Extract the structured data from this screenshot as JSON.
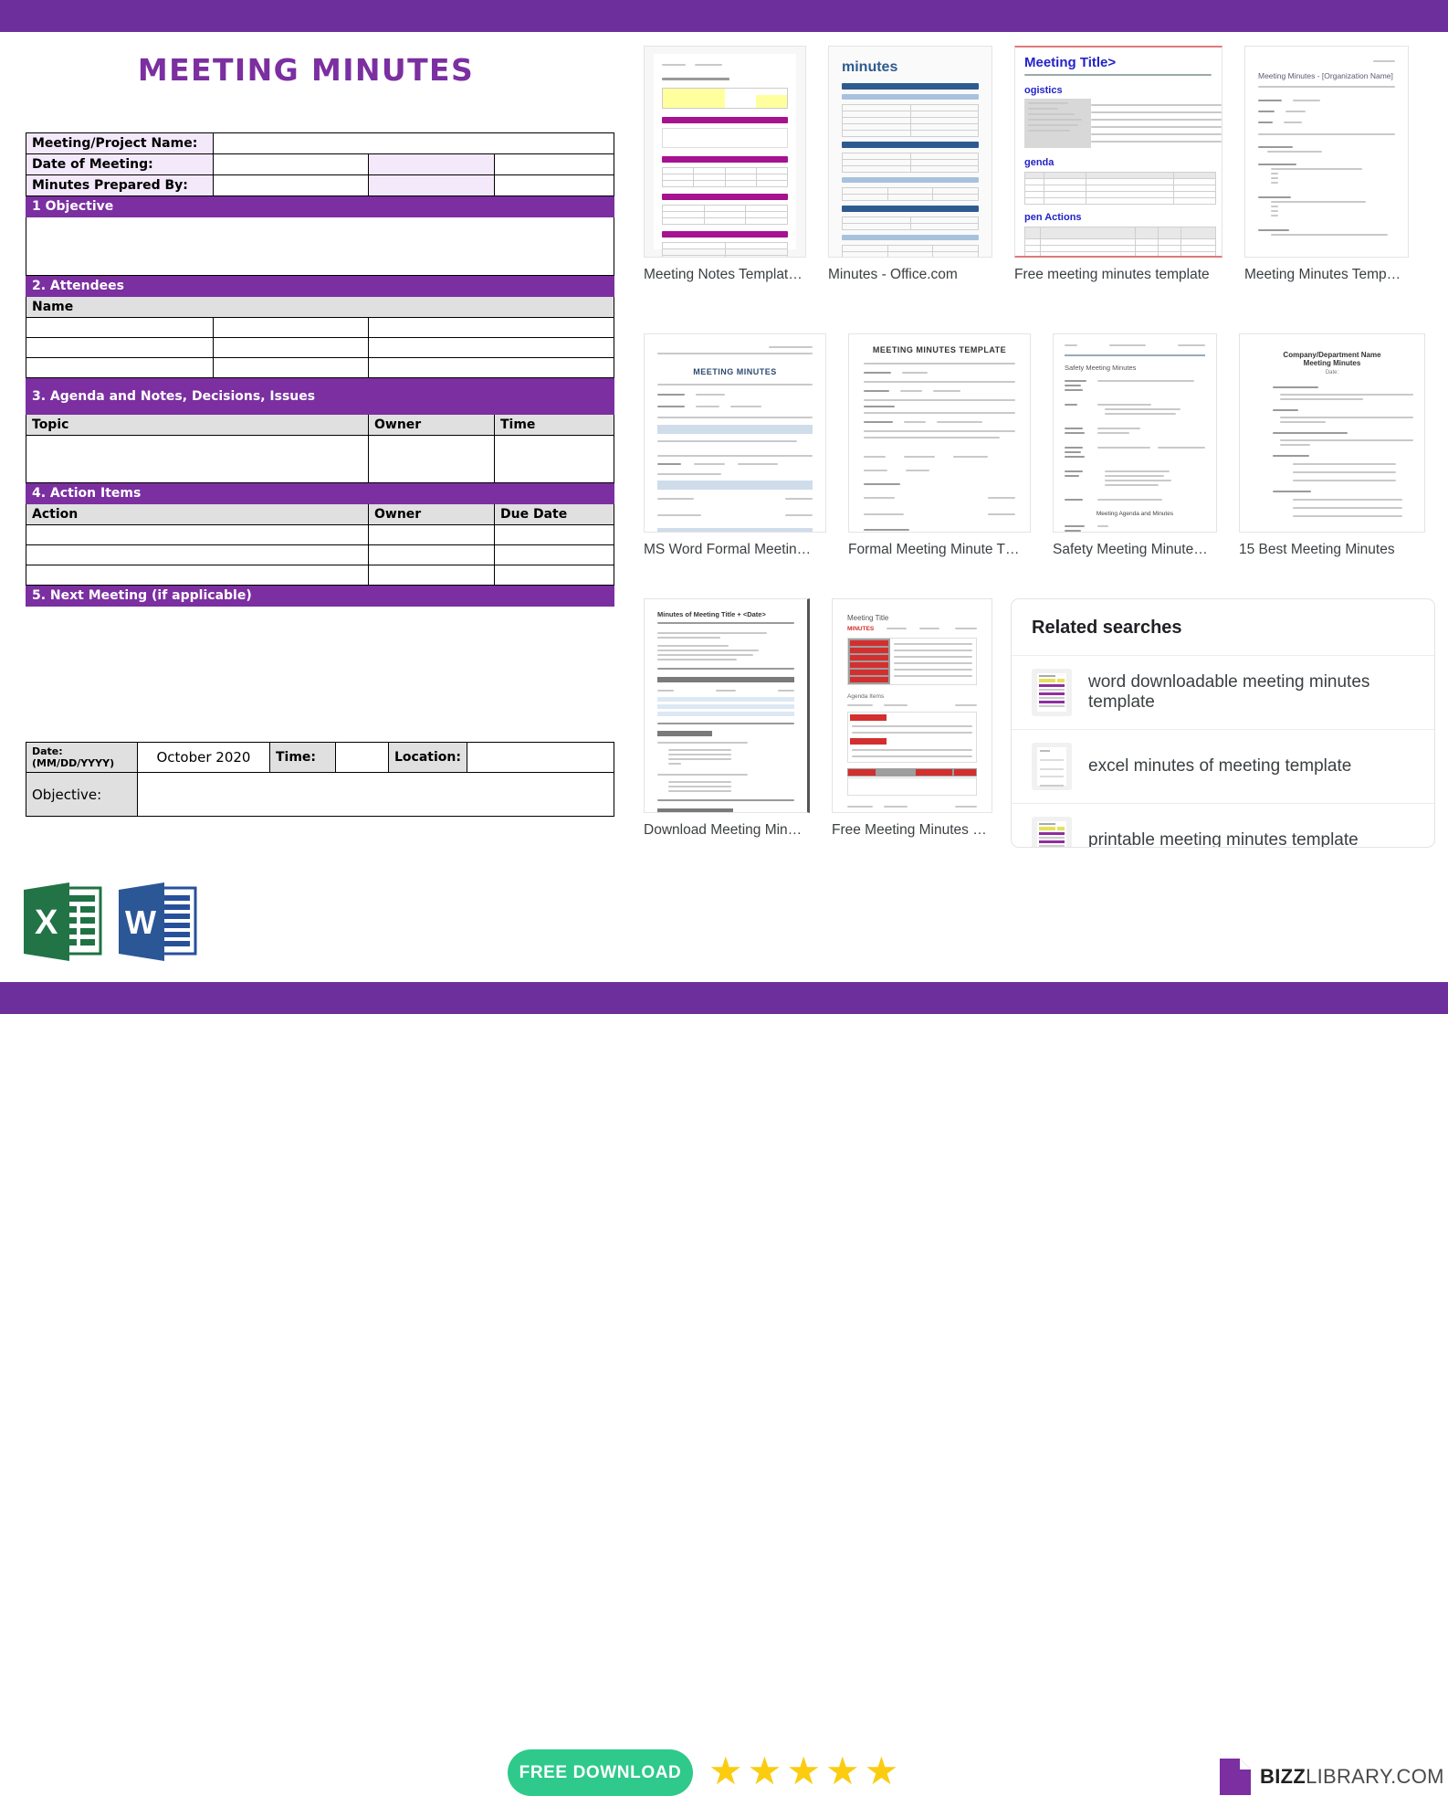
{
  "theme": {
    "purple": "#6d2f9c",
    "title_purple": "#7b2fa0",
    "lilac": "#f3e9fb",
    "header_grey": "#e0e0e0",
    "green_button": "#2ec98b",
    "star_yellow": "#fbcc10"
  },
  "document": {
    "title": "MEETING MINUTES",
    "info_rows": [
      {
        "label": "Meeting/Project Name:",
        "value": ""
      },
      {
        "label": "Date of Meeting:",
        "value": ""
      },
      {
        "label": "Minutes Prepared By:",
        "value": ""
      }
    ],
    "sections": {
      "objective": "1 Objective",
      "attendees": "2. Attendees",
      "agenda": "3. Agenda and Notes, Decisions, Issues",
      "action_items": "4. Action Items",
      "next_meeting": "5. Next Meeting (if applicable)"
    },
    "attendees_header": [
      "Name"
    ],
    "agenda_headers": [
      "Topic",
      "Owner",
      "Time"
    ],
    "action_headers": [
      "Action",
      "Owner",
      "Due Date"
    ],
    "next_meeting": {
      "date_label": "Date:",
      "date_format": "(MM/DD/YYYY)",
      "date_value": "October 2020",
      "time_label": "Time:",
      "time_value": "",
      "location_label": "Location:",
      "location_value": "",
      "objective_label": "Objective:",
      "objective_value": ""
    }
  },
  "results": {
    "row1": [
      {
        "caption": "Meeting Notes Templat…",
        "style": "agenda-magenta"
      },
      {
        "caption": "Minutes - Office.com",
        "style": "minutes-blue"
      },
      {
        "caption": "Free meeting minutes template",
        "style": "title-blue"
      },
      {
        "caption": "Meeting Minutes Temp…",
        "style": "plain-grey"
      }
    ],
    "row2": [
      {
        "caption": "MS Word Formal Meetin…",
        "style": "formal-blue"
      },
      {
        "caption": "Formal Meeting Minute T…",
        "style": "formal-plain"
      },
      {
        "caption": "Safety Meeting Minute…",
        "style": "safety"
      },
      {
        "caption": "15 Best Meeting Minutes",
        "style": "outline"
      }
    ],
    "row3": [
      {
        "caption": "Download Meeting Min…",
        "style": "meetingking"
      },
      {
        "caption": "Free Meeting Minutes …",
        "style": "red-grey"
      }
    ]
  },
  "related_searches": {
    "title": "Related searches",
    "items": [
      {
        "label": "word downloadable meeting minutes template",
        "thumb": "purple"
      },
      {
        "label": "excel minutes of meeting template",
        "thumb": "faint"
      },
      {
        "label": "printable meeting minutes template",
        "thumb": "purple"
      }
    ]
  },
  "footer": {
    "excel_icon": "excel-icon",
    "excel_letter": "X",
    "word_icon": "word-icon",
    "word_letter": "W",
    "download_label": "FREE DOWNLOAD",
    "rating_stars": 5,
    "star_glyph": "★",
    "logo_icon": "document-logo-icon",
    "logo_bold": "BIZZ",
    "logo_light": "LIBRARY.COM"
  }
}
